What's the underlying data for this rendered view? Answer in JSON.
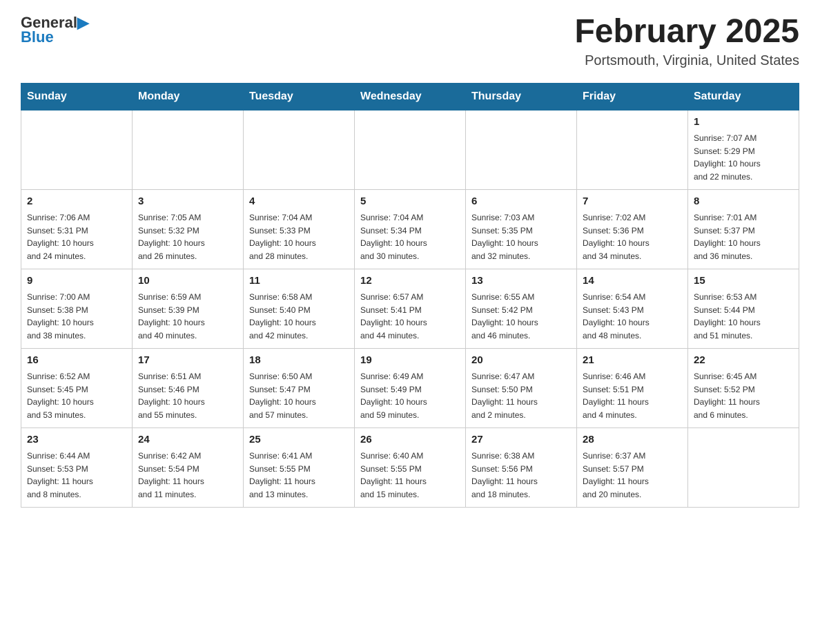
{
  "header": {
    "logo_general": "General",
    "logo_blue": "Blue",
    "month_title": "February 2025",
    "location": "Portsmouth, Virginia, United States"
  },
  "days_of_week": [
    "Sunday",
    "Monday",
    "Tuesday",
    "Wednesday",
    "Thursday",
    "Friday",
    "Saturday"
  ],
  "weeks": [
    [
      {
        "day": "",
        "info": ""
      },
      {
        "day": "",
        "info": ""
      },
      {
        "day": "",
        "info": ""
      },
      {
        "day": "",
        "info": ""
      },
      {
        "day": "",
        "info": ""
      },
      {
        "day": "",
        "info": ""
      },
      {
        "day": "1",
        "info": "Sunrise: 7:07 AM\nSunset: 5:29 PM\nDaylight: 10 hours\nand 22 minutes."
      }
    ],
    [
      {
        "day": "2",
        "info": "Sunrise: 7:06 AM\nSunset: 5:31 PM\nDaylight: 10 hours\nand 24 minutes."
      },
      {
        "day": "3",
        "info": "Sunrise: 7:05 AM\nSunset: 5:32 PM\nDaylight: 10 hours\nand 26 minutes."
      },
      {
        "day": "4",
        "info": "Sunrise: 7:04 AM\nSunset: 5:33 PM\nDaylight: 10 hours\nand 28 minutes."
      },
      {
        "day": "5",
        "info": "Sunrise: 7:04 AM\nSunset: 5:34 PM\nDaylight: 10 hours\nand 30 minutes."
      },
      {
        "day": "6",
        "info": "Sunrise: 7:03 AM\nSunset: 5:35 PM\nDaylight: 10 hours\nand 32 minutes."
      },
      {
        "day": "7",
        "info": "Sunrise: 7:02 AM\nSunset: 5:36 PM\nDaylight: 10 hours\nand 34 minutes."
      },
      {
        "day": "8",
        "info": "Sunrise: 7:01 AM\nSunset: 5:37 PM\nDaylight: 10 hours\nand 36 minutes."
      }
    ],
    [
      {
        "day": "9",
        "info": "Sunrise: 7:00 AM\nSunset: 5:38 PM\nDaylight: 10 hours\nand 38 minutes."
      },
      {
        "day": "10",
        "info": "Sunrise: 6:59 AM\nSunset: 5:39 PM\nDaylight: 10 hours\nand 40 minutes."
      },
      {
        "day": "11",
        "info": "Sunrise: 6:58 AM\nSunset: 5:40 PM\nDaylight: 10 hours\nand 42 minutes."
      },
      {
        "day": "12",
        "info": "Sunrise: 6:57 AM\nSunset: 5:41 PM\nDaylight: 10 hours\nand 44 minutes."
      },
      {
        "day": "13",
        "info": "Sunrise: 6:55 AM\nSunset: 5:42 PM\nDaylight: 10 hours\nand 46 minutes."
      },
      {
        "day": "14",
        "info": "Sunrise: 6:54 AM\nSunset: 5:43 PM\nDaylight: 10 hours\nand 48 minutes."
      },
      {
        "day": "15",
        "info": "Sunrise: 6:53 AM\nSunset: 5:44 PM\nDaylight: 10 hours\nand 51 minutes."
      }
    ],
    [
      {
        "day": "16",
        "info": "Sunrise: 6:52 AM\nSunset: 5:45 PM\nDaylight: 10 hours\nand 53 minutes."
      },
      {
        "day": "17",
        "info": "Sunrise: 6:51 AM\nSunset: 5:46 PM\nDaylight: 10 hours\nand 55 minutes."
      },
      {
        "day": "18",
        "info": "Sunrise: 6:50 AM\nSunset: 5:47 PM\nDaylight: 10 hours\nand 57 minutes."
      },
      {
        "day": "19",
        "info": "Sunrise: 6:49 AM\nSunset: 5:49 PM\nDaylight: 10 hours\nand 59 minutes."
      },
      {
        "day": "20",
        "info": "Sunrise: 6:47 AM\nSunset: 5:50 PM\nDaylight: 11 hours\nand 2 minutes."
      },
      {
        "day": "21",
        "info": "Sunrise: 6:46 AM\nSunset: 5:51 PM\nDaylight: 11 hours\nand 4 minutes."
      },
      {
        "day": "22",
        "info": "Sunrise: 6:45 AM\nSunset: 5:52 PM\nDaylight: 11 hours\nand 6 minutes."
      }
    ],
    [
      {
        "day": "23",
        "info": "Sunrise: 6:44 AM\nSunset: 5:53 PM\nDaylight: 11 hours\nand 8 minutes."
      },
      {
        "day": "24",
        "info": "Sunrise: 6:42 AM\nSunset: 5:54 PM\nDaylight: 11 hours\nand 11 minutes."
      },
      {
        "day": "25",
        "info": "Sunrise: 6:41 AM\nSunset: 5:55 PM\nDaylight: 11 hours\nand 13 minutes."
      },
      {
        "day": "26",
        "info": "Sunrise: 6:40 AM\nSunset: 5:55 PM\nDaylight: 11 hours\nand 15 minutes."
      },
      {
        "day": "27",
        "info": "Sunrise: 6:38 AM\nSunset: 5:56 PM\nDaylight: 11 hours\nand 18 minutes."
      },
      {
        "day": "28",
        "info": "Sunrise: 6:37 AM\nSunset: 5:57 PM\nDaylight: 11 hours\nand 20 minutes."
      },
      {
        "day": "",
        "info": ""
      }
    ]
  ]
}
